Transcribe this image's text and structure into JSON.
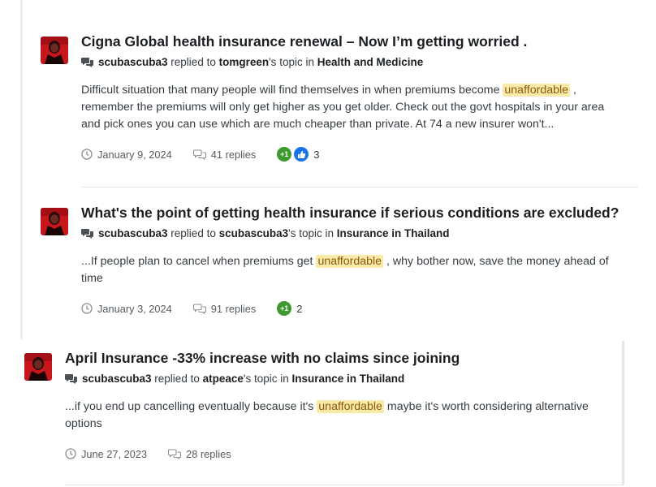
{
  "results": [
    {
      "title": "Cigna Global health insurance renewal – Now I’m getting worried .",
      "author": "scubascuba3",
      "replied_to": " replied to ",
      "topic_owner": "tomgreen",
      "topic_in": "'s topic in ",
      "forum": "Health and Medicine",
      "snippet_before": "Difficult situation that many people will find themselves in when premiums become ",
      "highlight": "unaffordable",
      "snippet_after": " , remember the premiums will only get higher as you get older. Check out the govt hospitals in your area and pick ones you can use which are much cheaper than private. At 74 a new insurer won't...",
      "date": "January 9, 2024",
      "replies": "41 replies",
      "plus_one_label": "+1",
      "has_like": true,
      "reaction_count": "3"
    },
    {
      "title": "What's the point of getting health insurance if serious conditions are excluded?",
      "author": "scubascuba3",
      "replied_to": " replied to ",
      "topic_owner": "scubascuba3",
      "topic_in": "'s topic in ",
      "forum": "Insurance in Thailand",
      "snippet_before": "...If people plan to cancel when premiums get ",
      "highlight": "unaffordable",
      "snippet_after": " , why bother now, save the money ahead of time",
      "date": "January 3, 2024",
      "replies": "91 replies",
      "plus_one_label": "+1",
      "has_like": false,
      "reaction_count": "2"
    },
    {
      "title": "April Insurance -33% increase with no claims since joining",
      "author": "scubascuba3",
      "replied_to": " replied to ",
      "topic_owner": "atpeace",
      "topic_in": "'s topic in ",
      "forum": "Insurance in Thailand",
      "snippet_before": "...if you end up cancelling eventually because it's ",
      "highlight": "unaffordable",
      "snippet_after": " maybe it's worth considering alternative options",
      "date": "June 27, 2023",
      "replies": "28 replies"
    }
  ],
  "colors": {
    "highlight_bg": "#faeaa9",
    "plus_one": "#3c9a2e",
    "like": "#1a73e8",
    "avatar": "#c8161d"
  },
  "icons": {
    "meta": "comments-icon",
    "date": "clock-icon",
    "replies": "speech-bubbles-icon",
    "like": "thumbs-up-icon"
  }
}
